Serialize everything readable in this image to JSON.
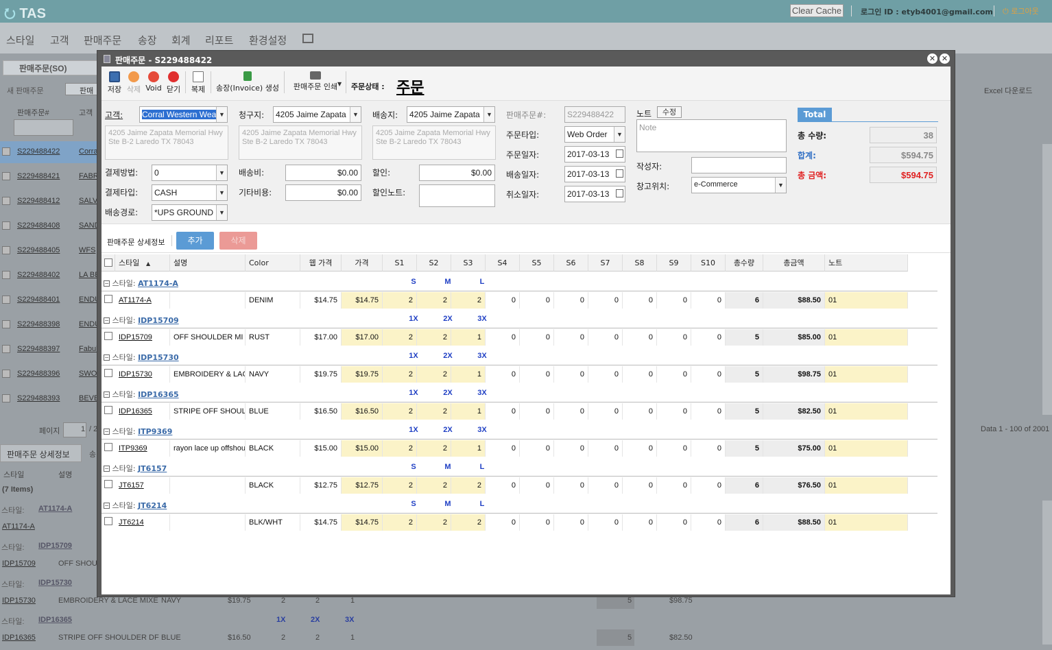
{
  "app": {
    "logo": "TAS",
    "clear_cache": "Clear Cache",
    "login_info": "로그인 ID : etyb4001@gmail.com",
    "logout": "로그아웃"
  },
  "menu": [
    "스타일",
    "고객",
    "판매주문",
    "송장",
    "회계",
    "리포트",
    "환경설정"
  ],
  "bg": {
    "tab_title": "판매주문(SO)",
    "new_order": "새 판매주문",
    "tab2": "판매",
    "excel": "Excel 다운로드",
    "col_so": "판매주문#",
    "col_cust": "고객",
    "so_rows": [
      "S229488422",
      "S229488421",
      "S229488412",
      "S229488408",
      "S229488405",
      "S229488402",
      "S229488401",
      "S229488398",
      "S229488397",
      "S229488396",
      "S229488393"
    ],
    "cust_rows": [
      "Corra",
      "FABR",
      "SALV",
      "SAND",
      "WFS",
      "LA BE",
      "ENDU",
      "ENDU",
      "Fabul",
      "SWO",
      "BEVE"
    ],
    "page_label": "페이지",
    "page_value": "1",
    "page_of": "/ 2",
    "data_range": "Data 1 - 100 of 2001",
    "detail_tab": "판매주문 상세정보",
    "detail_tab2": "송",
    "col_style": "스타일",
    "col_desc": "설명",
    "items": "(7 Items)",
    "groups": [
      {
        "label": "스타일:",
        "code": "AT1174-A",
        "row": "AT1174-A"
      },
      {
        "label": "스타일:",
        "code": "IDP15709",
        "row": "IDP15709",
        "desc": "OFF SHOU"
      },
      {
        "label": "스타일:",
        "code": "IDP15730",
        "row": "IDP15730",
        "desc": "EMBROIDERY & LACE MIXE",
        "color": "NAVY",
        "price": "$19.75",
        "s1": "2",
        "s2": "2",
        "s3": "1",
        "qty": "5",
        "amt": "$98.75"
      },
      {
        "label": "스타일:",
        "code": "IDP16365",
        "row": "IDP16365",
        "desc": "STRIPE OFF SHOULDER DF",
        "color": "BLUE",
        "price": "$16.50",
        "s1": "2",
        "s2": "2",
        "s3": "1",
        "qty": "5",
        "amt": "$82.50",
        "sizes": [
          "1X",
          "2X",
          "3X"
        ]
      }
    ],
    "zeros": "0"
  },
  "modal": {
    "title": "판매주문 - S229488422",
    "toolbar": {
      "save": "저장",
      "delete": "삭제",
      "void": "Void",
      "close": "닫기",
      "copy": "복제",
      "invoice": "송장(Invoice) 생성",
      "print": "판매주문 인쇄"
    },
    "status_label": "주문상태 :",
    "status_value": "주문",
    "form": {
      "customer_label": "고객:",
      "customer_value": "Corral Western Wear",
      "billto_label": "청구지:",
      "billto_value": "4205 Jaime Zapata",
      "shipto_label": "배송지:",
      "shipto_value": "4205 Jaime Zapata",
      "address": "4205 Jaime Zapata Memorial Hwy Ste B-2 Laredo TX 78043",
      "address2": "4205 Jaime Zapata Memorial Hwy Ste B-2  Laredo TX 78043",
      "so_label": "판매주문#:",
      "so_value": "S229488422",
      "ordertype_label": "주문타입:",
      "ordertype_value": "Web Order",
      "orderdate_label": "주문일자:",
      "orderdate_value": "2017-03-13",
      "shipdate_label": "배송일자:",
      "shipdate_value": "2017-03-13",
      "canceldate_label": "취소일자:",
      "canceldate_value": "2017-03-13",
      "payterm_label": "결제방법:",
      "payterm_value": "0",
      "paytype_label": "결제타입:",
      "paytype_value": "CASH",
      "shipvia_label": "배송경로:",
      "shipvia_value": "*UPS GROUND",
      "shipfee_label": "배송비:",
      "shipfee_value": "$0.00",
      "other_label": "기타비용:",
      "other_value": "$0.00",
      "discount_label": "할인:",
      "discount_value": "$0.00",
      "discnote_label": "할인노트:",
      "note_label": "노트",
      "note_edit": "수정",
      "note_placeholder": "Note",
      "writer_label": "작성자:",
      "warehouse_label": "창고위치:",
      "warehouse_value": "e-Commerce"
    },
    "total": {
      "header": "Total",
      "qty_label": "총 수량:",
      "qty_value": "38",
      "sum_label": "합계:",
      "sum_value": "$594.75",
      "grand_label": "총 금액:",
      "grand_value": "$594.75",
      "sum_color": "#2f6fc4",
      "grand_color": "#e02020"
    },
    "detail": {
      "title": "판매주문 상세정보",
      "add": "추가",
      "del": "삭제"
    },
    "columns": [
      "스타일",
      "설명",
      "Color",
      "웹 가격",
      "가격",
      "S1",
      "S2",
      "S3",
      "S4",
      "S5",
      "S6",
      "S7",
      "S8",
      "S9",
      "S10",
      "총수량",
      "총금액",
      "노트"
    ],
    "group_label": "스타일:",
    "lines": [
      {
        "style": "AT1174-A",
        "sizes": [
          "S",
          "M",
          "L"
        ],
        "desc": "",
        "color": "DENIM",
        "web": "$14.75",
        "price": "$14.75",
        "q": [
          "2",
          "2",
          "2",
          "0",
          "0",
          "0",
          "0",
          "0",
          "0",
          "0"
        ],
        "qty": "6",
        "amt": "$88.50",
        "note": "01"
      },
      {
        "style": "IDP15709",
        "sizes": [
          "1X",
          "2X",
          "3X"
        ],
        "desc": "OFF SHOULDER MI",
        "color": "RUST",
        "web": "$17.00",
        "price": "$17.00",
        "q": [
          "2",
          "2",
          "1",
          "0",
          "0",
          "0",
          "0",
          "0",
          "0",
          "0"
        ],
        "qty": "5",
        "amt": "$85.00",
        "note": "01"
      },
      {
        "style": "IDP15730",
        "sizes": [
          "1X",
          "2X",
          "3X"
        ],
        "desc": "EMBROIDERY & LAC",
        "color": "NAVY",
        "web": "$19.75",
        "price": "$19.75",
        "q": [
          "2",
          "2",
          "1",
          "0",
          "0",
          "0",
          "0",
          "0",
          "0",
          "0"
        ],
        "qty": "5",
        "amt": "$98.75",
        "note": "01"
      },
      {
        "style": "IDP16365",
        "sizes": [
          "1X",
          "2X",
          "3X"
        ],
        "desc": "STRIPE OFF SHOUL",
        "color": "BLUE",
        "web": "$16.50",
        "price": "$16.50",
        "q": [
          "2",
          "2",
          "1",
          "0",
          "0",
          "0",
          "0",
          "0",
          "0",
          "0"
        ],
        "qty": "5",
        "amt": "$82.50",
        "note": "01"
      },
      {
        "style": "ITP9369",
        "sizes": [
          "1X",
          "2X",
          "3X"
        ],
        "desc": "rayon lace up offshou",
        "color": "BLACK",
        "web": "$15.00",
        "price": "$15.00",
        "q": [
          "2",
          "2",
          "1",
          "0",
          "0",
          "0",
          "0",
          "0",
          "0",
          "0"
        ],
        "qty": "5",
        "amt": "$75.00",
        "note": "01"
      },
      {
        "style": "JT6157",
        "sizes": [
          "S",
          "M",
          "L"
        ],
        "desc": "",
        "color": "BLACK",
        "web": "$12.75",
        "price": "$12.75",
        "q": [
          "2",
          "2",
          "2",
          "0",
          "0",
          "0",
          "0",
          "0",
          "0",
          "0"
        ],
        "qty": "6",
        "amt": "$76.50",
        "note": "01"
      },
      {
        "style": "JT6214",
        "sizes": [
          "S",
          "M",
          "L"
        ],
        "desc": "",
        "color": "BLK/WHT",
        "web": "$14.75",
        "price": "$14.75",
        "q": [
          "2",
          "2",
          "2",
          "0",
          "0",
          "0",
          "0",
          "0",
          "0",
          "0"
        ],
        "qty": "6",
        "amt": "$88.50",
        "note": "01"
      }
    ]
  }
}
